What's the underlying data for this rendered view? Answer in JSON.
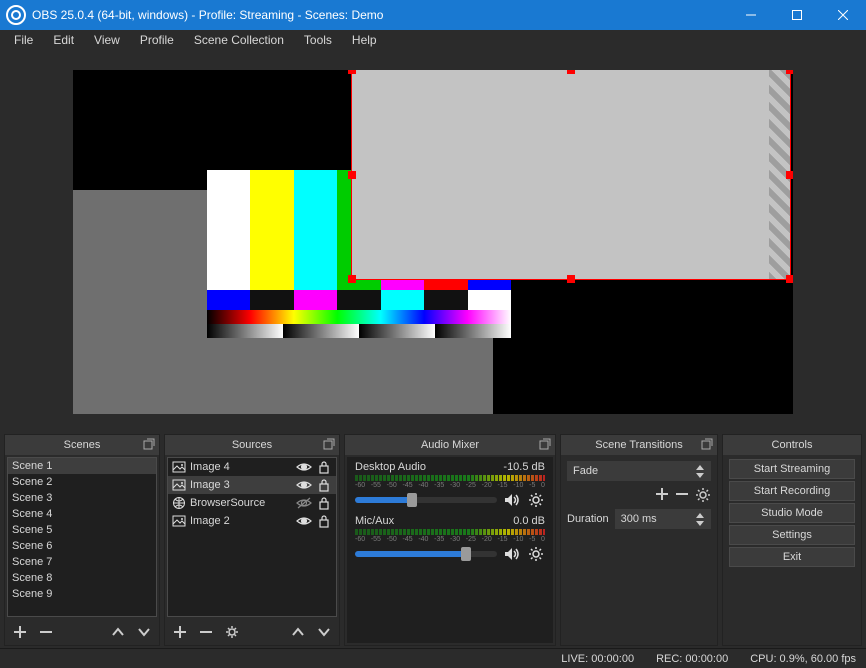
{
  "titlebar": {
    "title": "OBS 25.0.4 (64-bit, windows) - Profile: Streaming - Scenes: Demo"
  },
  "menu": [
    "File",
    "Edit",
    "View",
    "Profile",
    "Scene Collection",
    "Tools",
    "Help"
  ],
  "docks": {
    "scenes_title": "Scenes",
    "sources_title": "Sources",
    "mixer_title": "Audio Mixer",
    "transitions_title": "Scene Transitions",
    "controls_title": "Controls"
  },
  "scenes": [
    "Scene 1",
    "Scene 2",
    "Scene 3",
    "Scene 4",
    "Scene 5",
    "Scene 6",
    "Scene 7",
    "Scene 8",
    "Scene 9"
  ],
  "scene_selected": 0,
  "sources": [
    {
      "name": "Image 4",
      "visible": true,
      "locked": false,
      "type": "image"
    },
    {
      "name": "Image 3",
      "visible": true,
      "locked": false,
      "type": "image"
    },
    {
      "name": "BrowserSource",
      "visible": false,
      "locked": false,
      "type": "browser"
    },
    {
      "name": "Image 2",
      "visible": true,
      "locked": false,
      "type": "image"
    }
  ],
  "source_selected": 1,
  "mixer": {
    "ticks": [
      "-60",
      "-55",
      "-50",
      "-45",
      "-40",
      "-35",
      "-30",
      "-25",
      "-20",
      "-15",
      "-10",
      "-5",
      "0"
    ],
    "channels": [
      {
        "name": "Desktop Audio",
        "level": "-10.5 dB",
        "vol": 0.4
      },
      {
        "name": "Mic/Aux",
        "level": "0.0 dB",
        "vol": 0.78
      }
    ]
  },
  "transitions": {
    "selected": "Fade",
    "duration_label": "Duration",
    "duration_value": "300 ms"
  },
  "controls": [
    "Start Streaming",
    "Start Recording",
    "Studio Mode",
    "Settings",
    "Exit"
  ],
  "statusbar": {
    "live": "LIVE: 00:00:00",
    "rec": "REC: 00:00:00",
    "cpu": "CPU: 0.9%, 60.00 fps"
  }
}
